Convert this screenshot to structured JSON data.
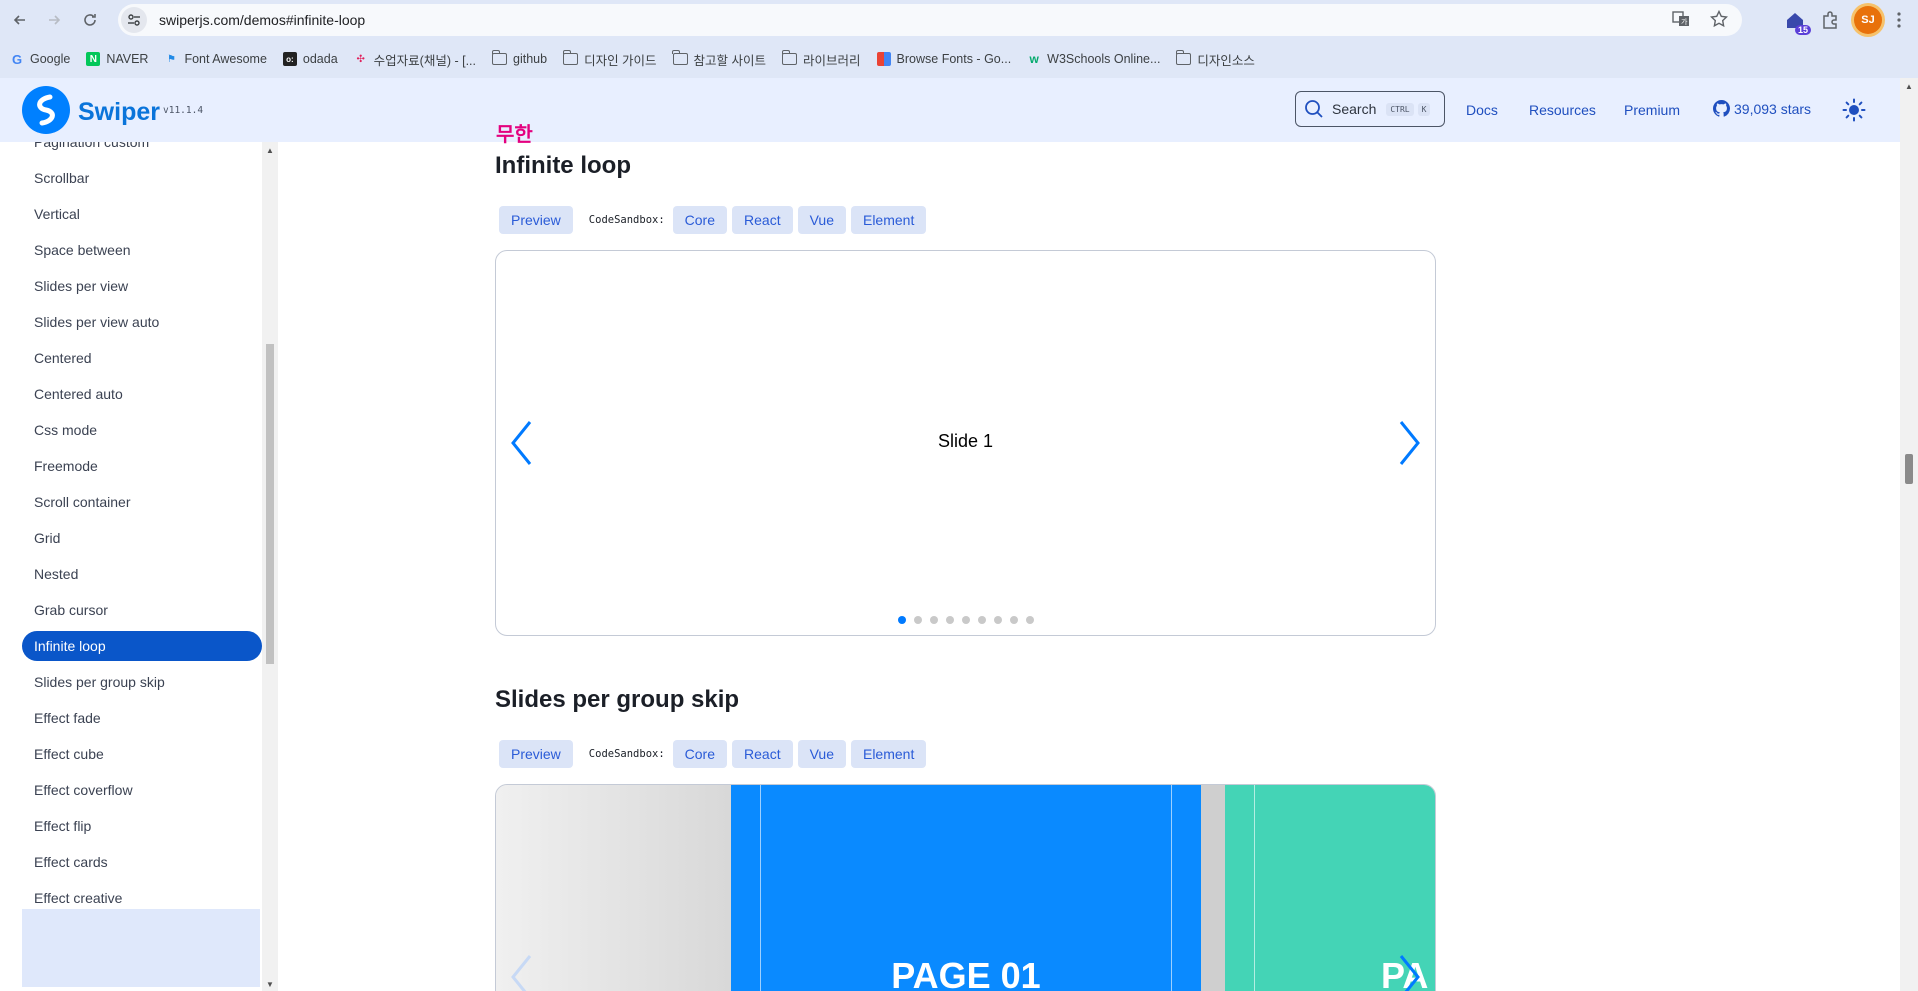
{
  "browser": {
    "url": "swiperjs.com/demos#infinite-loop",
    "extension_badge": "15",
    "profile_initials": "SJ"
  },
  "bookmarks": [
    {
      "label": "Google",
      "icon": "google-icon"
    },
    {
      "label": "NAVER",
      "icon": "naver-icon"
    },
    {
      "label": "Font Awesome",
      "icon": "fontawesome-icon"
    },
    {
      "label": "odada",
      "icon": "odada-icon"
    },
    {
      "label": "수업자료(채널) - [...",
      "icon": "slack-icon"
    },
    {
      "label": "github",
      "icon": "folder-icon"
    },
    {
      "label": "디자인 가이드",
      "icon": "folder-icon"
    },
    {
      "label": "참고할 사이트",
      "icon": "folder-icon"
    },
    {
      "label": "라이브러리",
      "icon": "folder-icon"
    },
    {
      "label": "Browse Fonts - Go...",
      "icon": "google-fonts-icon"
    },
    {
      "label": "W3Schools Online...",
      "icon": "w3schools-icon"
    },
    {
      "label": "디자인소스",
      "icon": "folder-icon"
    }
  ],
  "header": {
    "brand": "Swiper",
    "version": "v11.1.4",
    "search_label": "Search",
    "search_kbd_1": "CTRL",
    "search_kbd_2": "K",
    "nav": [
      "Docs",
      "Resources",
      "Premium"
    ],
    "stars": "39,093 stars"
  },
  "sidebar": {
    "items": [
      "Pagination custom",
      "Scrollbar",
      "Vertical",
      "Space between",
      "Slides per view",
      "Slides per view auto",
      "Centered",
      "Centered auto",
      "Css mode",
      "Freemode",
      "Scroll container",
      "Grid",
      "Nested",
      "Grab cursor",
      "Infinite loop",
      "Slides per group skip",
      "Effect fade",
      "Effect cube",
      "Effect coverflow",
      "Effect flip",
      "Effect cards",
      "Effect creative"
    ],
    "active": "Infinite loop"
  },
  "main": {
    "annotation": "무한",
    "sections": [
      {
        "title": "Infinite loop",
        "preview": "Preview",
        "codesandbox_label": "CodeSandbox:",
        "links": [
          "Core",
          "React",
          "Vue",
          "Element"
        ],
        "slide_text": "Slide 1",
        "pagination_count": 9,
        "active_dot": 1
      },
      {
        "title": "Slides per group skip",
        "preview": "Preview",
        "codesandbox_label": "CodeSandbox:",
        "links": [
          "Core",
          "React",
          "Vue",
          "Element"
        ],
        "page_title": "PAGE 01",
        "next_page_partial": "PA"
      }
    ]
  },
  "colors": {
    "accent": "#007aff",
    "sidebar_active": "#0a56c9",
    "header_bg": "#e8efff",
    "annotation": "#e4007f"
  }
}
